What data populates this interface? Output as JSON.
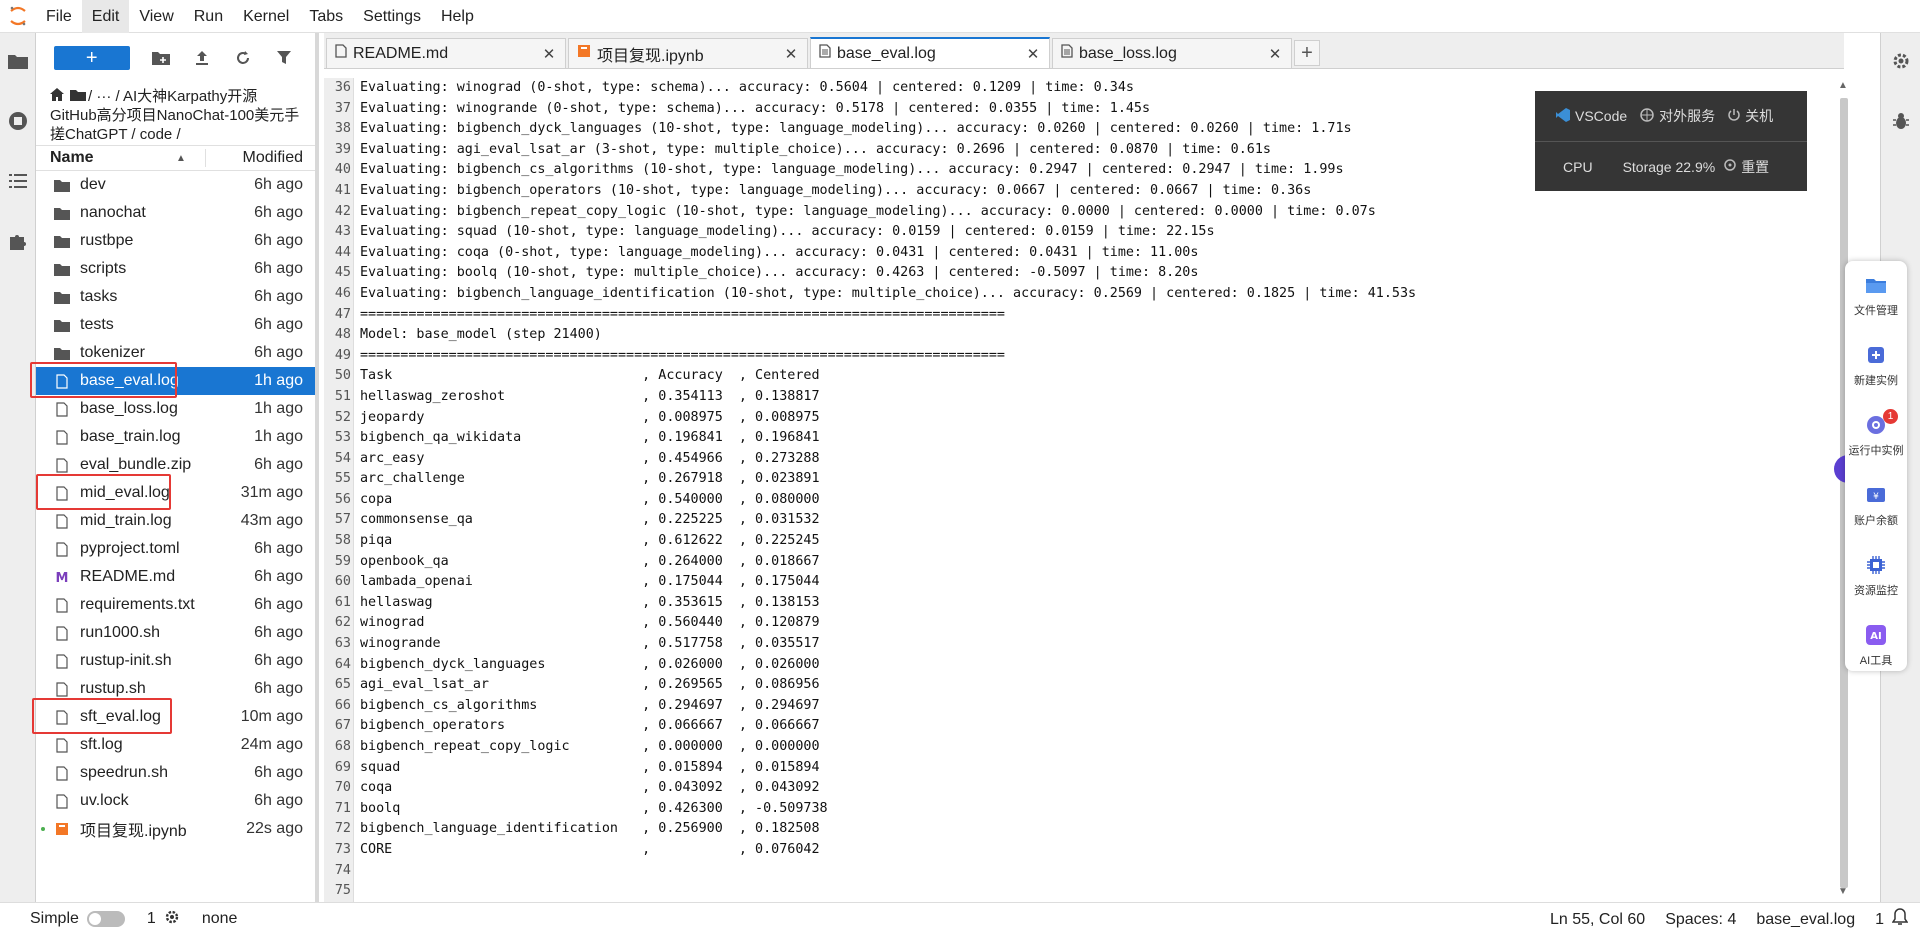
{
  "menu": [
    "File",
    "Edit",
    "View",
    "Run",
    "Kernel",
    "Tabs",
    "Settings",
    "Help"
  ],
  "menu_active": "Edit",
  "filebrowser": {
    "new_label": "+",
    "crumbs_line1": " /  ···  / AI大神Karpathy开源",
    "crumbs_line2": "GitHub高分项目NanoChat-100美元手",
    "crumbs_line3": "搓ChatGPT / code /",
    "col_name": "Name",
    "col_modified": "Modified",
    "files": [
      {
        "name": "dev",
        "mod": "6h ago",
        "icon": "folder"
      },
      {
        "name": "nanochat",
        "mod": "6h ago",
        "icon": "folder"
      },
      {
        "name": "rustbpe",
        "mod": "6h ago",
        "icon": "folder"
      },
      {
        "name": "scripts",
        "mod": "6h ago",
        "icon": "folder"
      },
      {
        "name": "tasks",
        "mod": "6h ago",
        "icon": "folder"
      },
      {
        "name": "tests",
        "mod": "6h ago",
        "icon": "folder"
      },
      {
        "name": "tokenizer",
        "mod": "6h ago",
        "icon": "folder"
      },
      {
        "name": "base_eval.log",
        "mod": "1h ago",
        "icon": "file",
        "selected": true
      },
      {
        "name": "base_loss.log",
        "mod": "1h ago",
        "icon": "file"
      },
      {
        "name": "base_train.log",
        "mod": "1h ago",
        "icon": "file"
      },
      {
        "name": "eval_bundle.zip",
        "mod": "6h ago",
        "icon": "file"
      },
      {
        "name": "mid_eval.log",
        "mod": "31m ago",
        "icon": "file"
      },
      {
        "name": "mid_train.log",
        "mod": "43m ago",
        "icon": "file"
      },
      {
        "name": "pyproject.toml",
        "mod": "6h ago",
        "icon": "file"
      },
      {
        "name": "README.md",
        "mod": "6h ago",
        "icon": "markdown"
      },
      {
        "name": "requirements.txt",
        "mod": "6h ago",
        "icon": "file"
      },
      {
        "name": "run1000.sh",
        "mod": "6h ago",
        "icon": "file"
      },
      {
        "name": "rustup-init.sh",
        "mod": "6h ago",
        "icon": "file"
      },
      {
        "name": "rustup.sh",
        "mod": "6h ago",
        "icon": "file"
      },
      {
        "name": "sft_eval.log",
        "mod": "10m ago",
        "icon": "file"
      },
      {
        "name": "sft.log",
        "mod": "24m ago",
        "icon": "file"
      },
      {
        "name": "speedrun.sh",
        "mod": "6h ago",
        "icon": "file"
      },
      {
        "name": "uv.lock",
        "mod": "6h ago",
        "icon": "file"
      },
      {
        "name": "项目复现.ipynb",
        "mod": "22s ago",
        "icon": "notebook",
        "running": true
      }
    ]
  },
  "tabs": [
    {
      "label": "README.md",
      "icon": "markdown"
    },
    {
      "label": "项目复现.ipynb",
      "icon": "notebook"
    },
    {
      "label": "base_eval.log",
      "icon": "file",
      "active": true
    },
    {
      "label": "base_loss.log",
      "icon": "file"
    }
  ],
  "editor_lines": [
    {
      "n": "36",
      "t": "Evaluating: winograd (0-shot, type: schema)... accuracy: 0.5604 | centered: 0.1209 | time: 0.34s"
    },
    {
      "n": "37",
      "t": "Evaluating: winogrande (0-shot, type: schema)... accuracy: 0.5178 | centered: 0.0355 | time: 1.45s"
    },
    {
      "n": "38",
      "t": "Evaluating: bigbench_dyck_languages (10-shot, type: language_modeling)... accuracy: 0.0260 | centered: 0.0260 | time: 1.71s"
    },
    {
      "n": "39",
      "t": "Evaluating: agi_eval_lsat_ar (3-shot, type: multiple_choice)... accuracy: 0.2696 | centered: 0.0870 | time: 0.61s"
    },
    {
      "n": "40",
      "t": "Evaluating: bigbench_cs_algorithms (10-shot, type: language_modeling)... accuracy: 0.2947 | centered: 0.2947 | time: 1.99s"
    },
    {
      "n": "41",
      "t": "Evaluating: bigbench_operators (10-shot, type: language_modeling)... accuracy: 0.0667 | centered: 0.0667 | time: 0.36s"
    },
    {
      "n": "42",
      "t": "Evaluating: bigbench_repeat_copy_logic (10-shot, type: language_modeling)... accuracy: 0.0000 | centered: 0.0000 | time: 0.07s"
    },
    {
      "n": "43",
      "t": "Evaluating: squad (10-shot, type: language_modeling)... accuracy: 0.0159 | centered: 0.0159 | time: 22.15s"
    },
    {
      "n": "44",
      "t": "Evaluating: coqa (0-shot, type: language_modeling)... accuracy: 0.0431 | centered: 0.0431 | time: 11.00s"
    },
    {
      "n": "45",
      "t": "Evaluating: boolq (10-shot, type: multiple_choice)... accuracy: 0.4263 | centered: -0.5097 | time: 8.20s"
    },
    {
      "n": "46",
      "t": "Evaluating: bigbench_language_identification (10-shot, type: multiple_choice)... accuracy: 0.2569 | centered: 0.1825 | time: 41.53s"
    },
    {
      "n": "47",
      "t": "================================================================================"
    },
    {
      "n": "48",
      "t": "Model: base_model (step 21400)"
    },
    {
      "n": "49",
      "t": "================================================================================"
    },
    {
      "n": "50",
      "t": "Task                               , Accuracy  , Centered"
    },
    {
      "n": "51",
      "t": "hellaswag_zeroshot                 , 0.354113  , 0.138817"
    },
    {
      "n": "52",
      "t": "jeopardy                           , 0.008975  , 0.008975"
    },
    {
      "n": "53",
      "t": "bigbench_qa_wikidata               , 0.196841  , 0.196841"
    },
    {
      "n": "54",
      "t": "arc_easy                           , 0.454966  , 0.273288"
    },
    {
      "n": "55",
      "t": "arc_challenge                      , 0.267918  , 0.023891"
    },
    {
      "n": "56",
      "t": "copa                               , 0.540000  , 0.080000"
    },
    {
      "n": "57",
      "t": "commonsense_qa                     , 0.225225  , 0.031532"
    },
    {
      "n": "58",
      "t": "piqa                               , 0.612622  , 0.225245"
    },
    {
      "n": "59",
      "t": "openbook_qa                        , 0.264000  , 0.018667"
    },
    {
      "n": "60",
      "t": "lambada_openai                     , 0.175044  , 0.175044"
    },
    {
      "n": "61",
      "t": "hellaswag                          , 0.353615  , 0.138153"
    },
    {
      "n": "62",
      "t": "winograd                           , 0.560440  , 0.120879"
    },
    {
      "n": "63",
      "t": "winogrande                         , 0.517758  , 0.035517"
    },
    {
      "n": "64",
      "t": "bigbench_dyck_languages            , 0.026000  , 0.026000"
    },
    {
      "n": "65",
      "t": "agi_eval_lsat_ar                   , 0.269565  , 0.086956"
    },
    {
      "n": "66",
      "t": "bigbench_cs_algorithms             , 0.294697  , 0.294697"
    },
    {
      "n": "67",
      "t": "bigbench_operators                 , 0.066667  , 0.066667"
    },
    {
      "n": "68",
      "t": "bigbench_repeat_copy_logic         , 0.000000  , 0.000000"
    },
    {
      "n": "69",
      "t": "squad                              , 0.015894  , 0.015894"
    },
    {
      "n": "70",
      "t": "coqa                               , 0.043092  , 0.043092"
    },
    {
      "n": "71",
      "t": "boolq                              , 0.426300  , -0.509738"
    },
    {
      "n": "72",
      "t": "bigbench_language_identification   , 0.256900  , 0.182508"
    },
    {
      "n": "73",
      "t": "CORE                               ,           , 0.076042"
    },
    {
      "n": "74",
      "t": ""
    },
    {
      "n": "75",
      "t": ""
    }
  ],
  "overlay": {
    "vscode": "VSCode",
    "service": "对外服务",
    "shutdown": "关机",
    "cpu": "CPU",
    "storage": "Storage 22.9%",
    "reset": "重置"
  },
  "toolbox": [
    {
      "label": "文件管理",
      "icon": "folder-icon"
    },
    {
      "label": "新建实例",
      "icon": "add-instance-icon"
    },
    {
      "label": "运行中实例",
      "icon": "running-instance-icon",
      "badge": "1"
    },
    {
      "label": "账户余额",
      "icon": "wallet-icon"
    },
    {
      "label": "资源监控",
      "icon": "chip-icon"
    },
    {
      "label": "AI工具",
      "icon": "ai-icon"
    }
  ],
  "status": {
    "mode": "Simple",
    "kernels": "1",
    "kernel_name": "none",
    "cursor": "Ln 55, Col 60",
    "spaces": "Spaces: 4",
    "filename": "base_eval.log",
    "notifications": "1"
  },
  "colors": {
    "accent": "#1976d2",
    "highlight": "#e53935",
    "overlay_bg": "#353535"
  }
}
